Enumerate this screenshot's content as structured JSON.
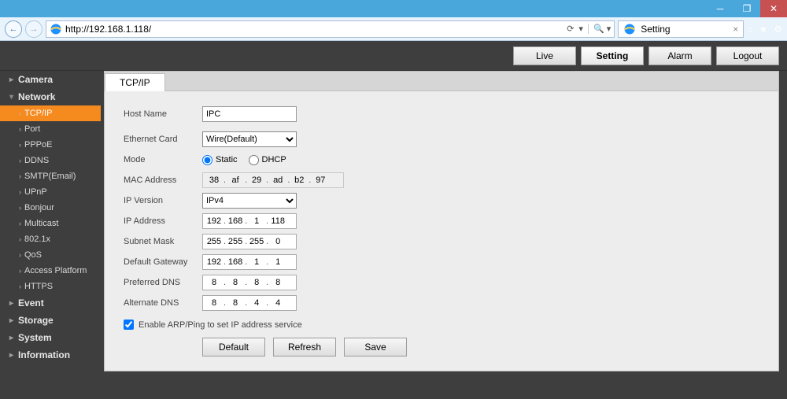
{
  "browser": {
    "url": "http://192.168.1.118/",
    "tab_title": "Setting"
  },
  "header": {
    "buttons": [
      "Live",
      "Setting",
      "Alarm",
      "Logout"
    ],
    "active": "Setting"
  },
  "sidebar": {
    "categories": [
      {
        "label": "Camera",
        "expanded": false,
        "items": []
      },
      {
        "label": "Network",
        "expanded": true,
        "items": [
          "TCP/IP",
          "Port",
          "PPPoE",
          "DDNS",
          "SMTP(Email)",
          "UPnP",
          "Bonjour",
          "Multicast",
          "802.1x",
          "QoS",
          "Access Platform",
          "HTTPS"
        ],
        "active": "TCP/IP"
      },
      {
        "label": "Event",
        "expanded": false,
        "items": []
      },
      {
        "label": "Storage",
        "expanded": false,
        "items": []
      },
      {
        "label": "System",
        "expanded": false,
        "items": []
      },
      {
        "label": "Information",
        "expanded": false,
        "items": []
      }
    ]
  },
  "content": {
    "tab_label": "TCP/IP",
    "labels": {
      "host_name": "Host Name",
      "ethernet_card": "Ethernet Card",
      "mode": "Mode",
      "mac": "MAC Address",
      "ipver": "IP Version",
      "ipaddr": "IP Address",
      "subnet": "Subnet Mask",
      "gateway": "Default Gateway",
      "pdns": "Preferred DNS",
      "adns": "Alternate DNS",
      "arp": "Enable ARP/Ping to set IP address service",
      "mode_static": "Static",
      "mode_dhcp": "DHCP"
    },
    "values": {
      "host_name": "IPC",
      "ethernet_card": "Wire(Default)",
      "mode": "Static",
      "mac": [
        "38",
        "af",
        "29",
        "ad",
        "b2",
        "97"
      ],
      "ipver": "IPv4",
      "ipaddr": [
        "192",
        "168",
        "1",
        "118"
      ],
      "subnet": [
        "255",
        "255",
        "255",
        "0"
      ],
      "gateway": [
        "192",
        "168",
        "1",
        "1"
      ],
      "pdns": [
        "8",
        "8",
        "8",
        "8"
      ],
      "adns": [
        "8",
        "8",
        "4",
        "4"
      ],
      "arp_checked": true
    },
    "buttons": {
      "default": "Default",
      "refresh": "Refresh",
      "save": "Save"
    }
  }
}
